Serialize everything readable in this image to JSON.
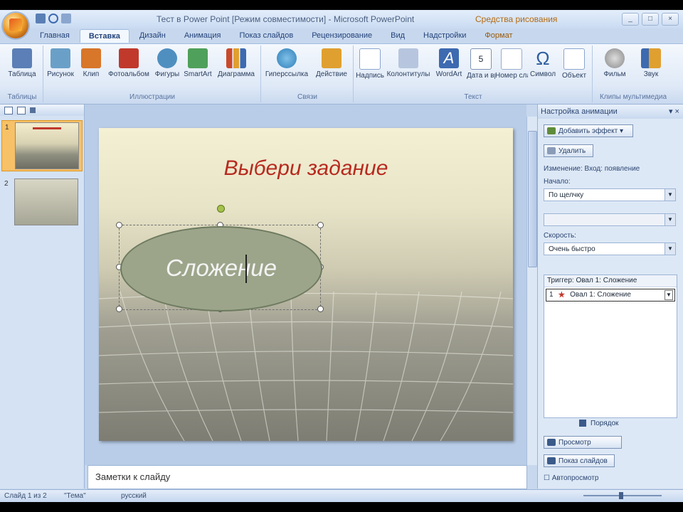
{
  "window": {
    "title": "Тест в Power Point [Режим совместимости] - Microsoft PowerPoint",
    "context_tab_title": "Средства рисования",
    "controls": [
      "_",
      "□",
      "×"
    ]
  },
  "tabs": [
    {
      "label": "Главная",
      "active": false
    },
    {
      "label": "Вставка",
      "active": true
    },
    {
      "label": "Дизайн",
      "active": false
    },
    {
      "label": "Анимация",
      "active": false
    },
    {
      "label": "Показ слайдов",
      "active": false
    },
    {
      "label": "Рецензирование",
      "active": false
    },
    {
      "label": "Вид",
      "active": false
    },
    {
      "label": "Надстройки",
      "active": false
    },
    {
      "label": "Формат",
      "active": false,
      "context": true
    }
  ],
  "ribbon": {
    "groups": [
      {
        "label": "Таблицы",
        "buttons": [
          {
            "label": "Таблица",
            "icon": "table-icon",
            "color": "#5b7fb6"
          }
        ]
      },
      {
        "label": "Иллюстрации",
        "buttons": [
          {
            "label": "Рисунок",
            "icon": "picture-icon",
            "color": "#6aa0c8"
          },
          {
            "label": "Клип",
            "icon": "clipart-icon",
            "color": "#d8762a"
          },
          {
            "label": "Фотоальбом",
            "icon": "photo-album-icon",
            "color": "#c0392b"
          },
          {
            "label": "Фигуры",
            "icon": "shapes-icon",
            "color": "#4f8fc0"
          },
          {
            "label": "SmartArt",
            "icon": "smartart-icon",
            "color": "#4fa05a"
          },
          {
            "label": "Диаграмма",
            "icon": "chart-icon",
            "color": "#c84a2a"
          }
        ]
      },
      {
        "label": "Связи",
        "buttons": [
          {
            "label": "Гиперссылка",
            "icon": "hyperlink-icon",
            "color": "#2f7fb8"
          },
          {
            "label": "Действие",
            "icon": "action-icon",
            "color": "#e0a030"
          }
        ]
      },
      {
        "label": "Текст",
        "buttons": [
          {
            "label": "Надпись",
            "icon": "textbox-icon",
            "color": "#8aa6cf"
          },
          {
            "label": "Колонтитулы",
            "icon": "header-footer-icon",
            "color": "#b7c6de"
          },
          {
            "label": "WordArt",
            "icon": "wordart-icon",
            "color": "#3d6ab0"
          },
          {
            "label": "Дата и время",
            "icon": "date-time-icon",
            "color": "#7f93b3"
          },
          {
            "label": "Номер слайда",
            "icon": "slide-number-icon",
            "color": "#9aaccc"
          },
          {
            "label": "Символ",
            "icon": "symbol-icon",
            "color": "#2f5f9f"
          },
          {
            "label": "Объект",
            "icon": "object-icon",
            "color": "#8aa6cf"
          }
        ]
      },
      {
        "label": "Клипы мультимедиа",
        "buttons": [
          {
            "label": "Фильм",
            "icon": "movie-icon",
            "color": "#8a8a8a"
          },
          {
            "label": "Звук",
            "icon": "sound-icon",
            "color": "#e0a030"
          }
        ]
      }
    ]
  },
  "slides": [
    {
      "number": "1",
      "selected": true
    },
    {
      "number": "2",
      "selected": false
    }
  ],
  "slide": {
    "title": "Выбери задание",
    "shape_text": "Сложение",
    "title_color": "#b72a1f"
  },
  "notes": {
    "placeholder": "Заметки к слайду"
  },
  "taskpane": {
    "title": "Настройка анимации",
    "add_effect": "Добавить эффект",
    "remove": "Удалить",
    "modify_label": "Изменение: Вход: появление",
    "start_label": "Начало:",
    "start_value": "По щелчку",
    "property_label": "",
    "speed_label": "Скорость:",
    "speed_value": "Очень быстро",
    "trigger_header": "Триггер: Овал 1: Сложение",
    "row_number": "1",
    "row_label": "Овал 1: Сложение",
    "reorder": "Порядок",
    "play": "Просмотр",
    "slideshow": "Показ слайдов",
    "autopreview": "Автопросмотр"
  },
  "status": {
    "slide_info": "Слайд 1 из 2",
    "theme": "\"Тема\"",
    "language": "русский"
  }
}
